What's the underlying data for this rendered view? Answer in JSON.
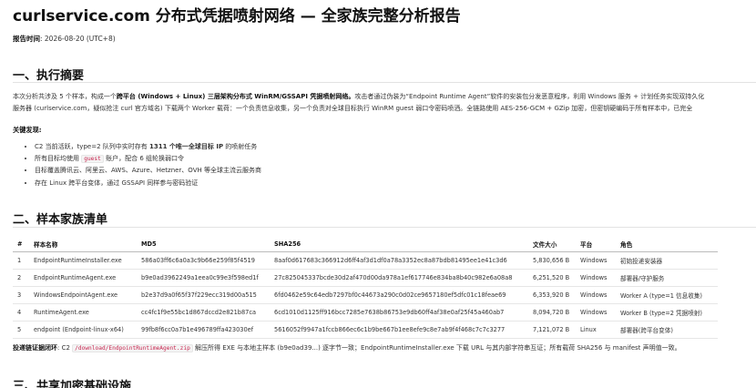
{
  "report": {
    "title": "curlservice.com 分布式凭据喷射网络 — 全家族完整分析报告",
    "meta_label": "报告时间",
    "meta_value": ": 2026-08-20 (UTC+8)"
  },
  "sections": [
    {
      "title": "一、执行摘要"
    },
    {
      "title": "二、样本家族清单"
    },
    {
      "title": "三、共享加密基础设施"
    }
  ],
  "summary": {
    "line1_prefix": "本次分析共涉及 5 个样本，构成一个",
    "line1_bold": "跨平台 (Windows + Linux) 三层架构分布式 WinRM/GSSAPI 凭据喷射网络。",
    "line1_suffix": "攻击者通过伪装为“Endpoint Runtime Agent”软件的安装包分发恶意程序，利用 Windows 服务 + 计划任务实现双持久化",
    "line2": "服务器 (curlservice.com，疑似抢注 curl 官方域名) 下载两个 Worker 载荷：一个负责信息收集，另一个负责对全球目标执行 WinRM guest 弱口令密码喷洒。全链路使用 AES-256-GCM + GZip 加密，但密钥硬编码于所有样本中，已完全"
  },
  "key_findings": {
    "label": "关键发现",
    "colon": ":",
    "items": [
      {
        "prefix": "C2 当前活跃，type=2 队列中实时存有 ",
        "bold": "1311 个唯一全球目标 IP",
        "suffix": " 的喷射任务"
      },
      {
        "prefix": "所有目标均使用 ",
        "code": "guest",
        "suffix": " 账户，配合 6 组轮换弱口令"
      },
      {
        "prefix": "目标覆盖腾讯云、阿里云、AWS、Azure、Hetzner、OVH 等全球主流云服务商"
      },
      {
        "prefix": "存在 Linux 跨平台变体，通过 GSSAPI 同样参与密码验证"
      }
    ]
  },
  "table": {
    "headers": [
      "#",
      "样本名称",
      "MD5",
      "SHA256",
      "文件大小",
      "平台",
      "角色"
    ],
    "rows": [
      [
        "1",
        "EndpointRuntimeInstaller.exe",
        "586a03ff6c6a0a3c9b66e259f85f4519",
        "8aaf0d617683c366912d6ff4af3d1df0a78a3352ec8a87bdb81495ee1e41c3d6",
        "5,830,656 B",
        "Windows",
        "初始投递安装器"
      ],
      [
        "2",
        "EndpointRuntimeAgent.exe",
        "b9e0ad3962249a1eea0c99e3f598ed1f",
        "27c825045337bcde30d2af470d00da978a1ef617746e834ba8b40c982e6a08a8",
        "6,251,520 B",
        "Windows",
        "部署器/守护服务"
      ],
      [
        "3",
        "WindowsEndpointAgent.exe",
        "b2e37d9a0f65f37f229ecc319d00a515",
        "6fd0462e59c64edb7297bf0c44673a290c0d02ce9657180ef5dfc01c18feae69",
        "6,353,920 B",
        "Windows",
        "Worker A (type=1 信息收集)"
      ],
      [
        "4",
        "RuntimeAgent.exe",
        "cc4fc1f9e55bc1d867dccd2e821b87ca",
        "6cd1010d1125ff916bcc7285e7638b86753e9db60ff4af38e0af25f45a460ab7",
        "8,094,720 B",
        "Windows",
        "Worker B (type=2 凭据喷射)"
      ],
      [
        "5",
        "endpoint (Endpoint-linux-x64)",
        "99fb8f6cc0a7b1e496789ffa423030ef",
        "5616052f9947a1fccb866ec6c1b9be667b1ee8efe9c8e7ab9f4f468c7c7c3277",
        "7,121,072 B",
        "Linux",
        "部署器(跨平台变体)"
      ]
    ]
  },
  "chain": {
    "bold": "投递链证据闭环",
    "prefix": ": C2 ",
    "code": "/download/EndpointRuntimeAgent.zip",
    "suffix": " 解压所得 EXE 与本地主样本 (b9e0ad39...) 逐字节一致；EndpointRuntimeInstaller.exe 下载 URL 与其内部字符串互证；所有载荷 SHA256 与 manifest 声明值一致。"
  }
}
